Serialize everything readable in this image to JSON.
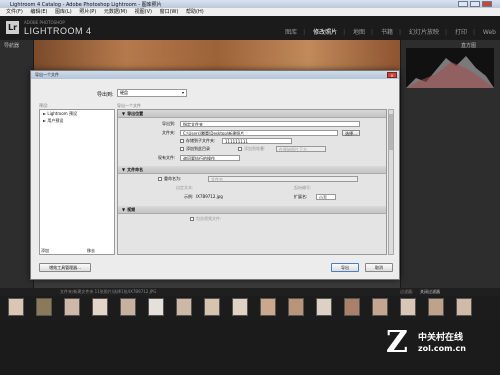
{
  "window": {
    "title": "Lightroom 4 Catalog - Adobe Photoshop Lightroom - 图库照片"
  },
  "menubar": {
    "items": [
      "文件(F)",
      "编辑(E)",
      "图库(L)",
      "照片(P)",
      "元数据(M)",
      "视图(V)",
      "窗口(W)",
      "帮助(H)"
    ]
  },
  "lr_header": {
    "logo": "Lr",
    "subtitle": "ADOBE PHOTOSHOP",
    "name": "LIGHTROOM 4",
    "modules": [
      "图库",
      "修改照片",
      "地图",
      "书籍",
      "幻灯片放映",
      "打印",
      "Web"
    ],
    "active_module": "修改照片"
  },
  "panels": {
    "navigator": "导航器",
    "histogram": "直方图"
  },
  "dialog": {
    "title": "导出一个文件",
    "export_to_label": "导出到:",
    "export_to_value": "硬盘",
    "presets_heading": "预设:",
    "files_heading": "导出一个文件",
    "presets": [
      "► Lightroom 预设",
      "► 用户预设"
    ],
    "add_label": "添加",
    "remove_label": "移去",
    "plugin_manager_label": "增效工具管理器...",
    "export_label": "导出",
    "cancel_label": "取消",
    "sections": {
      "location": {
        "title": "导出位置",
        "export_to_label": "导出到:",
        "export_to_value": "指定文件夹",
        "folder_label": "文件夹:",
        "folder_value": "C:\\Users\\腾蕾\\Desktop\\新建照片",
        "choose_label": "选择...",
        "subfolder_label": "存储到子文件夹:",
        "subfolder_value": "111111111",
        "add_to_catalog_label": "添加到此目录",
        "add_to_stack_label": "添加到堆叠:",
        "stack_position_value": "在原始照片下方",
        "existing_files_label": "现有文件:",
        "existing_files_value": "询问要执行的操作"
      },
      "naming": {
        "title": "文件命名",
        "rename_label": "重命名为:",
        "rename_value": "文件名",
        "custom_text_label": "自定文本:",
        "start_number_label": "起始编号:",
        "example_label": "示例:",
        "example_value": "IX7B9712.jpg",
        "extension_label": "扩展名:",
        "extension_value": "小写"
      },
      "video": {
        "title": "视频",
        "include_video_label": "包含视频文件:"
      }
    }
  },
  "filmstrip": {
    "info": "文件夹/新建文件夹  11张照片/选择1张/IX7B9712.JPG",
    "filter_label": "过滤器:",
    "filter_value": "关闭过滤器"
  },
  "watermark": {
    "logo": "Z",
    "name": "中关村在线",
    "url": "zol.com.cn"
  },
  "colors": {
    "lr_background": "#262626",
    "dialog_background": "#ececec",
    "accent_blue": "#4a7fc1"
  }
}
